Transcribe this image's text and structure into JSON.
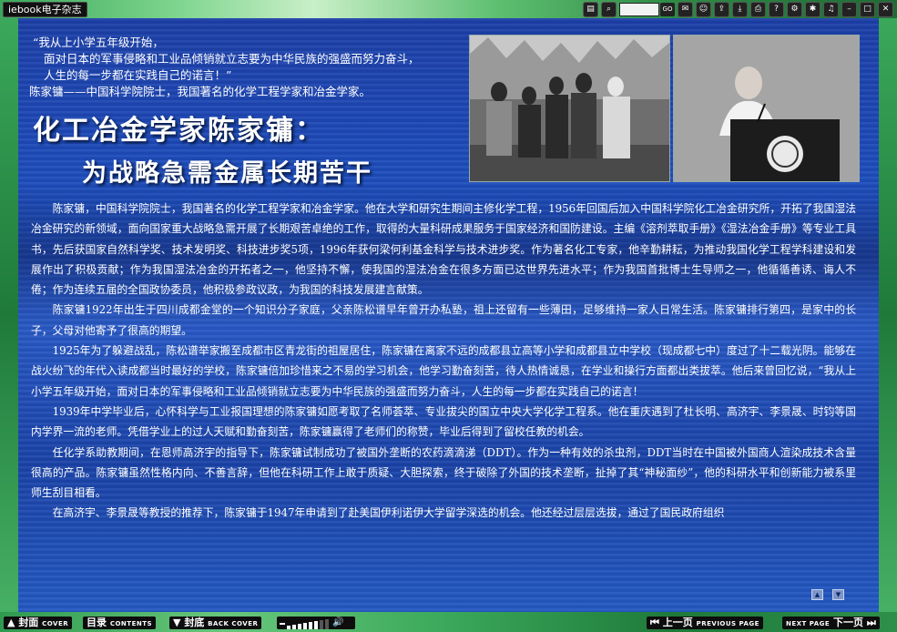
{
  "app": {
    "title": "iebook电子杂志"
  },
  "toolbar": {
    "page_value": "",
    "go_label": "GO"
  },
  "article": {
    "quote_lines": [
      "“我从上小学五年级开始，",
      "面对日本的军事侵略和工业品倾销就立志要为中华民族的强盛而努力奋斗，",
      "人生的每一步都在实践自己的诺言！”",
      "陈家镛——中国科学院院士，我国著名的化学工程学家和冶金学家。"
    ],
    "headline_line1": "化工冶金学家陈家镛：",
    "headline_line2": "为战略急需金属长期苦干",
    "paragraphs": [
      "陈家镛，中国科学院院士，我国著名的化学工程学家和冶金学家。他在大学和研究生期间主修化学工程，1956年回国后加入中国科学院化工冶金研究所，开拓了我国湿法冶金研究的新领域，面向国家重大战略急需开展了长期艰苦卓绝的工作，取得的大量科研成果服务于国家经济和国防建设。主编《溶剂萃取手册》《湿法冶金手册》等专业工具书，先后获国家自然科学奖、技术发明奖、科技进步奖5项，1996年获何梁何利基金科学与技术进步奖。作为著名化工专家，他辛勤耕耘，为推动我国化学工程学科建设和发展作出了积极贡献；作为我国湿法冶金的开拓者之一，他坚持不懈，使我国的湿法冶金在很多方面已达世界先进水平；作为我国首批博士生导师之一，他循循善诱、诲人不倦；作为连续五届的全国政协委员，他积极参政议政，为我国的科技发展建言献策。",
      "陈家镛1922年出生于四川成都金堂的一个知识分子家庭，父亲陈松谱早年曾开办私塾，祖上还留有一些薄田，足够维持一家人日常生活。陈家镛排行第四，是家中的长子，父母对他寄予了很高的期望。",
      "1925年为了躲避战乱，陈松谱举家搬至成都市区青龙街的祖屋居住，陈家镛在离家不远的成都县立高等小学和成都县立中学校（现成都七中）度过了十二载光阴。能够在战火纷飞的年代入读成都当时最好的学校，陈家镛倍加珍惜来之不易的学习机会，他学习勤奋刻苦，待人热情诚恳，在学业和操行方面都出类拔萃。他后来曾回忆说，“我从上小学五年级开始，面对日本的军事侵略和工业品倾销就立志要为中华民族的强盛而努力奋斗，人生的每一步都在实践自己的诺言！",
      "1939年中学毕业后，心怀科学与工业报国理想的陈家镛如愿考取了名师荟萃、专业拔尖的国立中央大学化学工程系。他在重庆遇到了杜长明、高济宇、李景晟、时钧等国内学界一流的老师。凭借学业上的过人天赋和勤奋刻苦，陈家镛赢得了老师们的称赞，毕业后得到了留校任教的机会。",
      "任化学系助教期间，在恩师高济宇的指导下，陈家镛试制成功了被国外垄断的农药滴滴涕（DDT）。作为一种有效的杀虫剂，DDT当时在中国被外国商人渲染成技术含量很高的产品。陈家镛虽然性格内向、不善言辞，但他在科研工作上敢于质疑、大胆探索，终于破除了外国的技术垄断，扯掉了其“神秘面纱”，他的科研水平和创新能力被系里师生刮目相看。",
      "在高济宇、李景晟等教授的推荐下，陈家镛于1947年申请到了赴美国伊利诺伊大学留学深选的机会。他还经过层层选拔，通过了国民政府组织"
    ]
  },
  "bottom": {
    "cover_label": "封面",
    "cover_en": "COVER",
    "contents_label": "目录",
    "contents_en": "CONTENTS",
    "back_label": "封底",
    "back_en": "BACK COVER",
    "prev_label": "上一页",
    "prev_en": "PREVIOUS PAGE",
    "next_en": "NEXT PAGE",
    "next_label": "下一页"
  },
  "volume": {
    "level": 0.75
  },
  "colors": {
    "frame": "#3aa85a",
    "page": "#1e4fbf",
    "toolbar_button": "#111111"
  }
}
